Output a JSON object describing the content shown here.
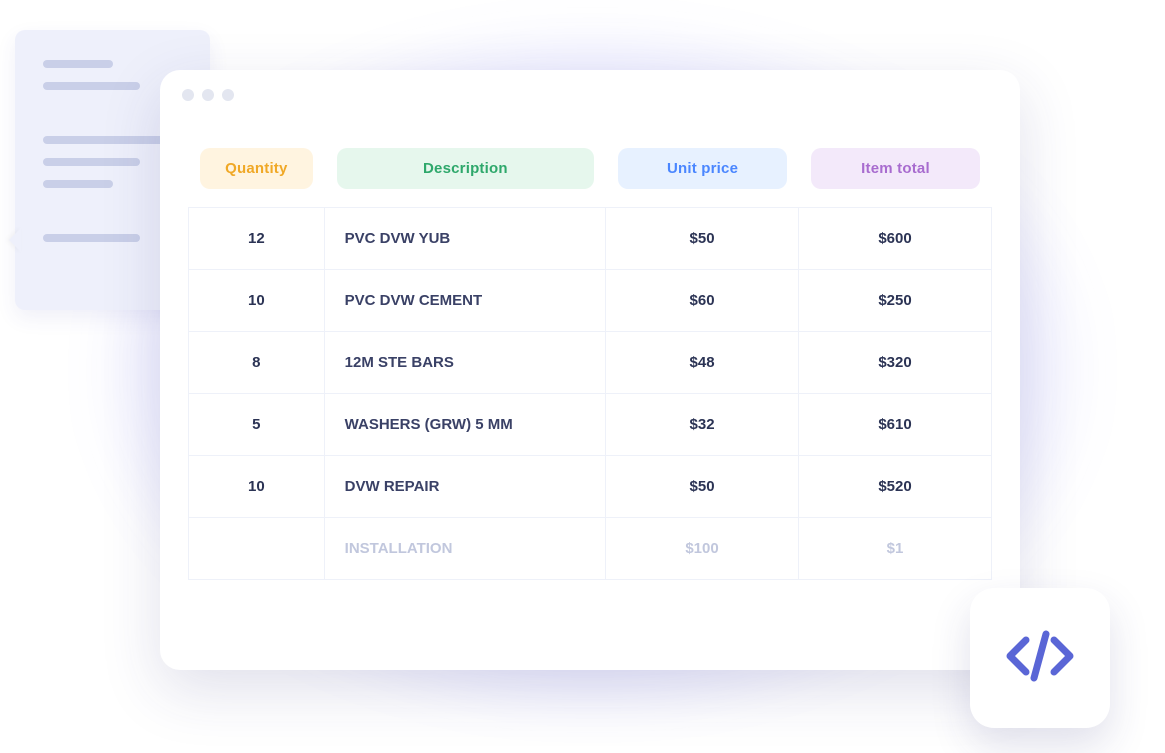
{
  "table": {
    "headers": {
      "quantity": "Quantity",
      "description": "Description",
      "unit_price": "Unit price",
      "item_total": "Item total"
    },
    "rows": [
      {
        "quantity": "12",
        "description": "PVC DVW YUB",
        "unit_price": "$50",
        "item_total": "$600",
        "faded": false
      },
      {
        "quantity": "10",
        "description": "PVC DVW CEMENT",
        "unit_price": "$60",
        "item_total": "$250",
        "faded": false
      },
      {
        "quantity": "8",
        "description": "12M STE BARS",
        "unit_price": "$48",
        "item_total": "$320",
        "faded": false
      },
      {
        "quantity": "5",
        "description": "WASHERS (GRW) 5 MM",
        "unit_price": "$32",
        "item_total": "$610",
        "faded": false
      },
      {
        "quantity": "10",
        "description": "DVW REPAIR",
        "unit_price": "$50",
        "item_total": "$520",
        "faded": false
      },
      {
        "quantity": "",
        "description": "INSTALLATION",
        "unit_price": "$100",
        "item_total": "$1",
        "faded": true
      }
    ]
  },
  "colors": {
    "accent_glow": "#5253ff",
    "header_qty_bg": "#fff4e0",
    "header_qty_fg": "#f0a826",
    "header_desc_bg": "#e6f7ed",
    "header_desc_fg": "#2ea86b",
    "header_unit_bg": "#e7f1ff",
    "header_unit_fg": "#4a86ff",
    "header_total_bg": "#f3e9fa",
    "header_total_fg": "#a86ccf"
  },
  "icons": {
    "code_badge": "code-icon"
  }
}
